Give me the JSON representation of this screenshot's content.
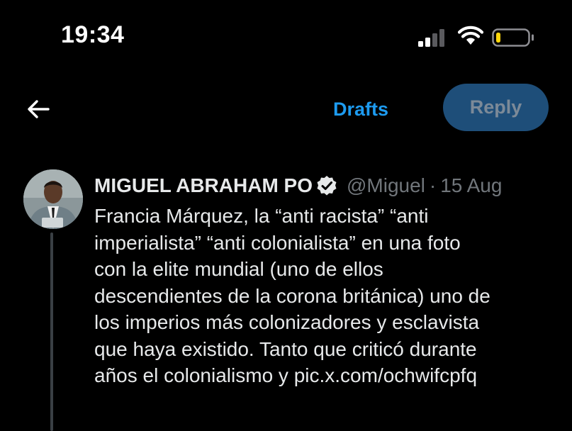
{
  "status_bar": {
    "time": "19:34",
    "signal_icon": "cellular-signal-icon",
    "wifi_icon": "wifi-icon",
    "battery_icon": "battery-low-icon",
    "battery_color": "#ffd60a"
  },
  "header": {
    "back_icon": "arrow-left-icon",
    "drafts_label": "Drafts",
    "reply_label": "Reply",
    "accent_color": "#1d9bf0"
  },
  "tweet": {
    "display_name": "MIGUEL ABRAHAM PO",
    "verified_icon": "verified-badge-icon",
    "handle": "@Miguel",
    "separator": "·",
    "date": "15 Aug",
    "lines": [
      "Francia Márquez, la “anti racista” “anti",
      "imperialista” “anti colonialista” en una foto",
      "con la elite mundial (uno de ellos",
      "descendientes de la corona británica) uno de",
      "los imperios más colonizadores y esclavista",
      "que haya existido. Tanto que criticó durante",
      "años el colonialismo y pic.x.com/ochwifcpfq"
    ]
  }
}
